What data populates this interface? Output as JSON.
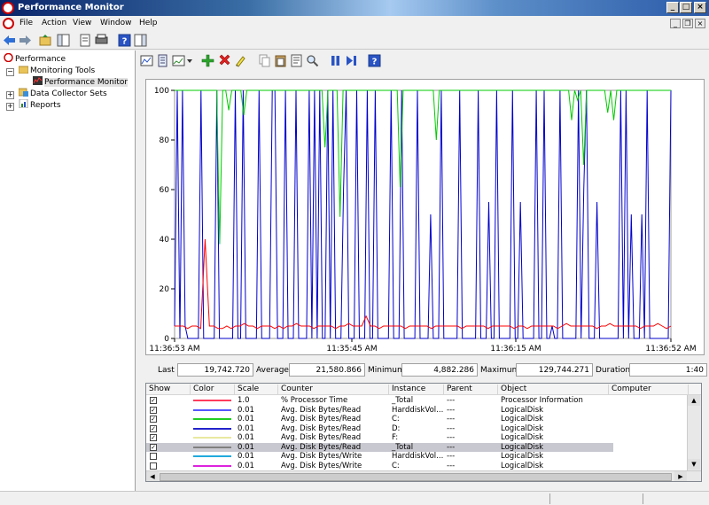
{
  "window": {
    "title": "Performance Monitor"
  },
  "menu": {
    "items": [
      "File",
      "Action",
      "View",
      "Window",
      "Help"
    ]
  },
  "tree": {
    "items": [
      {
        "label": "Performance",
        "level": 0
      },
      {
        "label": "Monitoring Tools",
        "level": 1
      },
      {
        "label": "Performance Monitor",
        "level": 2
      },
      {
        "label": "Data Collector Sets",
        "level": 1
      },
      {
        "label": "Reports",
        "level": 1
      }
    ]
  },
  "chart_data": {
    "type": "line",
    "ylim": [
      0,
      100
    ],
    "y_ticks": [
      "100",
      "80",
      "60",
      "40",
      "20",
      "0"
    ],
    "x_ticks": [
      "11:36:53 AM",
      "11:35:45 AM",
      "11:36:15 AM",
      "11:36:52 AM"
    ],
    "grid": false,
    "series": [
      {
        "name": "% Processor Time",
        "color": "#ff0000",
        "values": [
          5,
          5,
          5,
          4,
          5,
          5,
          4,
          40,
          5,
          5,
          4,
          4,
          5,
          4,
          5,
          5,
          6,
          5,
          5,
          4,
          5,
          5,
          5,
          4,
          5,
          4,
          5,
          5,
          6,
          5,
          5,
          5,
          4,
          5,
          5,
          5,
          5,
          4,
          5,
          5,
          6,
          5,
          5,
          5,
          9,
          5,
          5,
          4,
          5,
          5,
          5,
          5,
          5,
          4,
          5,
          5,
          5,
          5,
          5,
          4,
          5,
          5,
          5,
          5,
          5,
          5,
          4,
          5,
          5,
          5,
          5,
          5,
          4,
          5,
          5,
          5,
          5,
          5,
          4,
          5,
          5,
          4,
          5,
          5,
          5,
          5,
          5,
          5,
          4,
          5,
          6,
          5,
          5,
          5,
          5,
          5,
          5,
          4,
          5,
          5,
          6,
          5,
          5,
          5,
          5,
          5,
          5,
          4,
          5,
          5,
          5,
          6,
          5,
          4,
          5
        ]
      },
      {
        "name": "Avg. Disk Bytes/Read C:",
        "color": "#00cc00",
        "values": [
          100,
          100,
          100,
          100,
          100,
          100,
          100,
          100,
          100,
          100,
          100,
          100,
          100,
          100,
          100,
          38,
          100,
          100,
          92,
          100,
          100,
          100,
          100,
          90,
          100,
          100,
          100,
          100,
          100,
          100,
          100,
          100,
          100,
          100,
          100,
          100,
          100,
          100,
          100,
          100,
          100,
          100,
          100,
          100,
          100,
          100,
          100,
          100,
          100,
          100,
          77,
          100,
          100,
          100,
          100,
          49,
          100,
          100,
          100,
          100,
          100,
          100,
          100,
          100,
          100,
          100,
          100,
          100,
          100,
          100,
          100,
          100,
          100,
          100,
          100,
          61,
          100,
          100,
          100,
          100,
          100,
          100,
          100,
          100,
          100,
          100,
          100,
          80,
          100,
          100,
          100,
          100,
          100,
          100,
          100,
          100,
          100,
          100,
          100,
          100,
          100,
          100,
          100,
          100,
          100,
          100,
          100,
          100,
          100,
          100,
          100,
          100,
          100,
          100,
          100,
          100,
          100,
          100,
          100,
          100,
          100,
          100,
          100,
          100,
          100,
          100,
          100,
          100,
          100,
          100,
          100,
          100,
          88,
          100,
          96,
          100,
          70,
          100,
          100,
          100,
          100,
          100,
          100,
          100,
          91,
          100,
          88,
          100,
          100,
          100,
          100,
          100,
          100,
          100,
          100,
          100,
          100,
          100,
          100,
          100,
          100,
          100,
          100,
          100,
          100,
          100
        ]
      },
      {
        "name": "Avg. Disk Bytes/Read D:",
        "color": "#0000cc",
        "values": [
          5,
          100,
          0,
          100,
          5,
          0,
          0,
          0,
          0,
          0,
          100,
          0,
          0,
          0,
          0,
          0,
          100,
          0,
          0,
          0,
          0,
          0,
          0,
          100,
          0,
          0,
          100,
          0,
          0,
          0,
          0,
          0,
          100,
          0,
          0,
          0,
          0,
          100,
          100,
          0,
          0,
          0,
          100,
          0,
          0,
          0,
          100,
          0,
          0,
          0,
          0,
          100,
          0,
          100,
          0,
          100,
          0,
          0,
          100,
          0,
          100,
          0,
          0,
          0,
          60,
          100,
          0,
          0,
          0,
          100,
          0,
          0,
          0,
          100,
          0,
          0,
          100,
          0,
          0,
          0,
          0,
          0,
          100,
          0,
          0,
          0,
          100,
          0,
          0,
          0,
          0,
          0,
          100,
          0,
          0,
          0,
          0,
          50,
          0,
          0,
          0,
          100,
          0,
          0,
          0,
          0,
          0,
          0,
          100,
          0,
          0,
          0,
          0,
          0,
          0,
          100,
          0,
          0,
          0,
          55,
          0,
          0,
          100,
          0,
          0,
          0,
          0,
          0,
          100,
          0,
          0,
          55,
          0,
          0,
          0,
          0,
          0,
          100,
          0,
          0,
          100,
          0,
          0,
          5,
          0,
          0,
          100,
          0,
          0,
          0,
          0,
          0,
          0,
          100,
          0,
          60,
          100,
          0,
          0,
          0,
          55,
          0,
          0,
          0,
          0,
          0,
          0,
          0,
          0,
          100,
          0,
          100,
          0,
          50,
          0,
          0,
          0,
          50,
          0,
          100,
          0,
          0,
          0,
          0,
          0,
          0,
          0,
          0,
          100
        ]
      }
    ]
  },
  "stats": {
    "last_label": "Last",
    "last_value": "19,742.720",
    "average_label": "Average",
    "average_value": "21,580.866",
    "minimum_label": "Minimum",
    "minimum_value": "4,882.286",
    "maximum_label": "Maximum",
    "maximum_value": "129,744.271",
    "duration_label": "Duration",
    "duration_value": "1:40"
  },
  "legend": {
    "columns": [
      "Show",
      "Color",
      "Scale",
      "Counter",
      "Instance",
      "Parent",
      "Object",
      "Computer"
    ],
    "rows": [
      {
        "show": true,
        "color": "#ff3b5c",
        "scale": "1.0",
        "counter": "% Processor Time",
        "instance": "_Total",
        "parent": "---",
        "object": "Processor Information",
        "selected": false
      },
      {
        "show": true,
        "color": "#5555ff",
        "scale": "0.01",
        "counter": "Avg. Disk Bytes/Read",
        "instance": "HarddiskVol...",
        "parent": "---",
        "object": "LogicalDisk",
        "selected": false
      },
      {
        "show": true,
        "color": "#22cc22",
        "scale": "0.01",
        "counter": "Avg. Disk Bytes/Read",
        "instance": "C:",
        "parent": "---",
        "object": "LogicalDisk",
        "selected": false
      },
      {
        "show": true,
        "color": "#2222cc",
        "scale": "0.01",
        "counter": "Avg. Disk Bytes/Read",
        "instance": "D:",
        "parent": "---",
        "object": "LogicalDisk",
        "selected": false
      },
      {
        "show": true,
        "color": "#e8e8a0",
        "scale": "0.01",
        "counter": "Avg. Disk Bytes/Read",
        "instance": "F:",
        "parent": "---",
        "object": "LogicalDisk",
        "selected": false
      },
      {
        "show": true,
        "color": "#808080",
        "scale": "0.01",
        "counter": "Avg. Disk Bytes/Read",
        "instance": "_Total",
        "parent": "---",
        "object": "LogicalDisk",
        "selected": true
      },
      {
        "show": false,
        "color": "#22aadd",
        "scale": "0.01",
        "counter": "Avg. Disk Bytes/Write",
        "instance": "HarddiskVol...",
        "parent": "---",
        "object": "LogicalDisk",
        "selected": false
      },
      {
        "show": false,
        "color": "#dd22dd",
        "scale": "0.01",
        "counter": "Avg. Disk Bytes/Write",
        "instance": "C:",
        "parent": "---",
        "object": "LogicalDisk",
        "selected": false
      }
    ]
  }
}
